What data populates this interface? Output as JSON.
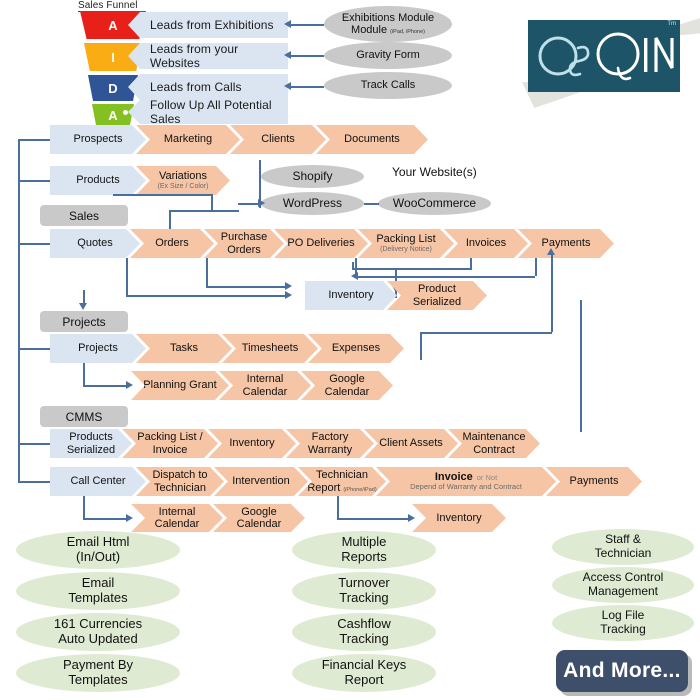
{
  "funnel": {
    "title": "Sales Funnel",
    "segments": [
      {
        "letter": "A",
        "color": "#e8201a",
        "label": "Leads from Exhibitions",
        "source": "Exhibitions Module",
        "source_sub": "(iPad, iPhone)"
      },
      {
        "letter": "I",
        "color": "#f9ac14",
        "label": "Leads from your Websites",
        "source": "Gravity Form",
        "source_sub": ""
      },
      {
        "letter": "D",
        "color": "#2f5597",
        "label": "Leads from Calls",
        "source": "Track Calls",
        "source_sub": ""
      },
      {
        "letter": "A",
        "color": "#84c021",
        "label": "Follow Up All Potential Sales",
        "source": "",
        "source_sub": ""
      }
    ]
  },
  "logo": {
    "text": "OsQin",
    "tm": "Tm",
    "bg": "#1e5468"
  },
  "websites": {
    "heading": "Your Website(s)",
    "nodes": [
      "Shopify",
      "WordPress",
      "WooCommerce"
    ]
  },
  "sections": [
    {
      "chip": "Sales"
    },
    {
      "chip": "Projects"
    },
    {
      "chip": "CMMS"
    }
  ],
  "rows": {
    "prospects": {
      "steps": [
        {
          "label": "Prospects",
          "kind": "first"
        },
        {
          "label": "Marketing",
          "kind": "mid"
        },
        {
          "label": "Clients",
          "kind": "mid"
        },
        {
          "label": "Documents",
          "kind": "mid"
        }
      ]
    },
    "products": {
      "steps": [
        {
          "label": "Products",
          "kind": "first"
        },
        {
          "label": "Variations",
          "sub": "(Ex Size / Color)",
          "kind": "mid"
        }
      ]
    },
    "quotes": {
      "steps": [
        {
          "label": "Quotes",
          "kind": "first"
        },
        {
          "label": "Orders",
          "kind": "mid"
        },
        {
          "label": "Purchase",
          "label2": "Orders",
          "kind": "mid"
        },
        {
          "label": "PO Deliveries",
          "kind": "mid"
        },
        {
          "label": "Packing List",
          "sub": "(Delivery Notice)",
          "kind": "mid"
        },
        {
          "label": "Invoices",
          "kind": "mid"
        },
        {
          "label": "Payments",
          "kind": "mid"
        }
      ]
    },
    "inventory": {
      "steps": [
        {
          "label": "Inventory",
          "kind": "first"
        },
        {
          "label": "Product",
          "label2": "Serialized",
          "kind": "mid"
        }
      ]
    },
    "projects": {
      "steps": [
        {
          "label": "Projects",
          "kind": "first"
        },
        {
          "label": "Tasks",
          "kind": "mid"
        },
        {
          "label": "Timesheets",
          "kind": "mid"
        },
        {
          "label": "Expenses",
          "kind": "mid"
        }
      ]
    },
    "planning": {
      "steps": [
        {
          "label": "Planning Grant",
          "kind": "mid"
        },
        {
          "label": "Internal",
          "label2": "Calendar",
          "kind": "mid"
        },
        {
          "label": "Google",
          "label2": "Calendar",
          "kind": "mid"
        }
      ]
    },
    "cmms": {
      "steps": [
        {
          "label": "Products",
          "label2": "Serialized",
          "kind": "first"
        },
        {
          "label": "Packing List /",
          "label2": "Invoice",
          "kind": "mid"
        },
        {
          "label": "Inventory",
          "kind": "mid"
        },
        {
          "label": "Factory",
          "label2": "Warranty",
          "kind": "mid"
        },
        {
          "label": "Client Assets",
          "kind": "mid"
        },
        {
          "label": "Maintenance",
          "label2": "Contract",
          "kind": "mid"
        }
      ]
    },
    "callcenter": {
      "steps": [
        {
          "label": "Call Center",
          "kind": "first"
        },
        {
          "label": "Dispatch to",
          "label2": "Technician",
          "kind": "mid"
        },
        {
          "label": "Intervention",
          "kind": "mid"
        },
        {
          "label": "Technician",
          "label2": "Report",
          "tiny": "(iPhone/iPad)",
          "kind": "mid"
        },
        {
          "label": "Invoice",
          "muted": "or Not",
          "label2": "Depend of Warranty and Contract",
          "kind": "mid"
        },
        {
          "label": "Payments",
          "kind": "mid"
        }
      ]
    },
    "calendars": {
      "steps": [
        {
          "label": "Internal",
          "label2": "Calendar",
          "kind": "mid"
        },
        {
          "label": "Google",
          "label2": "Calendar",
          "kind": "mid"
        }
      ]
    },
    "cc_inventory": {
      "steps": [
        {
          "label": "Inventory",
          "kind": "mid"
        }
      ]
    }
  },
  "features": {
    "col1": [
      {
        "line1": "Email Html",
        "line2": "(In/Out)"
      },
      {
        "line1": "Email",
        "line2": "Templates"
      },
      {
        "line1": "161 Currencies",
        "line2": "Auto Updated"
      },
      {
        "line1": "Payment By",
        "line2": "Templates"
      }
    ],
    "col2": [
      {
        "line1": "Multiple",
        "line2": "Reports"
      },
      {
        "line1": "Turnover",
        "line2": "Tracking"
      },
      {
        "line1": "Cashflow",
        "line2": "Tracking"
      },
      {
        "line1": "Financial Keys",
        "line2": "Report"
      }
    ],
    "col3": [
      {
        "line1": "Staff &",
        "line2": "Technician"
      },
      {
        "line1": "Access Control",
        "line2": "Management"
      },
      {
        "line1": "Log File",
        "line2": "Tracking"
      }
    ]
  },
  "cta": {
    "label": "And More..."
  },
  "colors": {
    "chevron_first": "#dbe5f1",
    "chevron_mid": "#f6c5a5",
    "chip": "#c9c9c9",
    "oval_grey": "#c9c9c9",
    "oval_green": "#dfead2",
    "connector": "#4a6f9c",
    "cta_bg": "#3d4f6b"
  }
}
